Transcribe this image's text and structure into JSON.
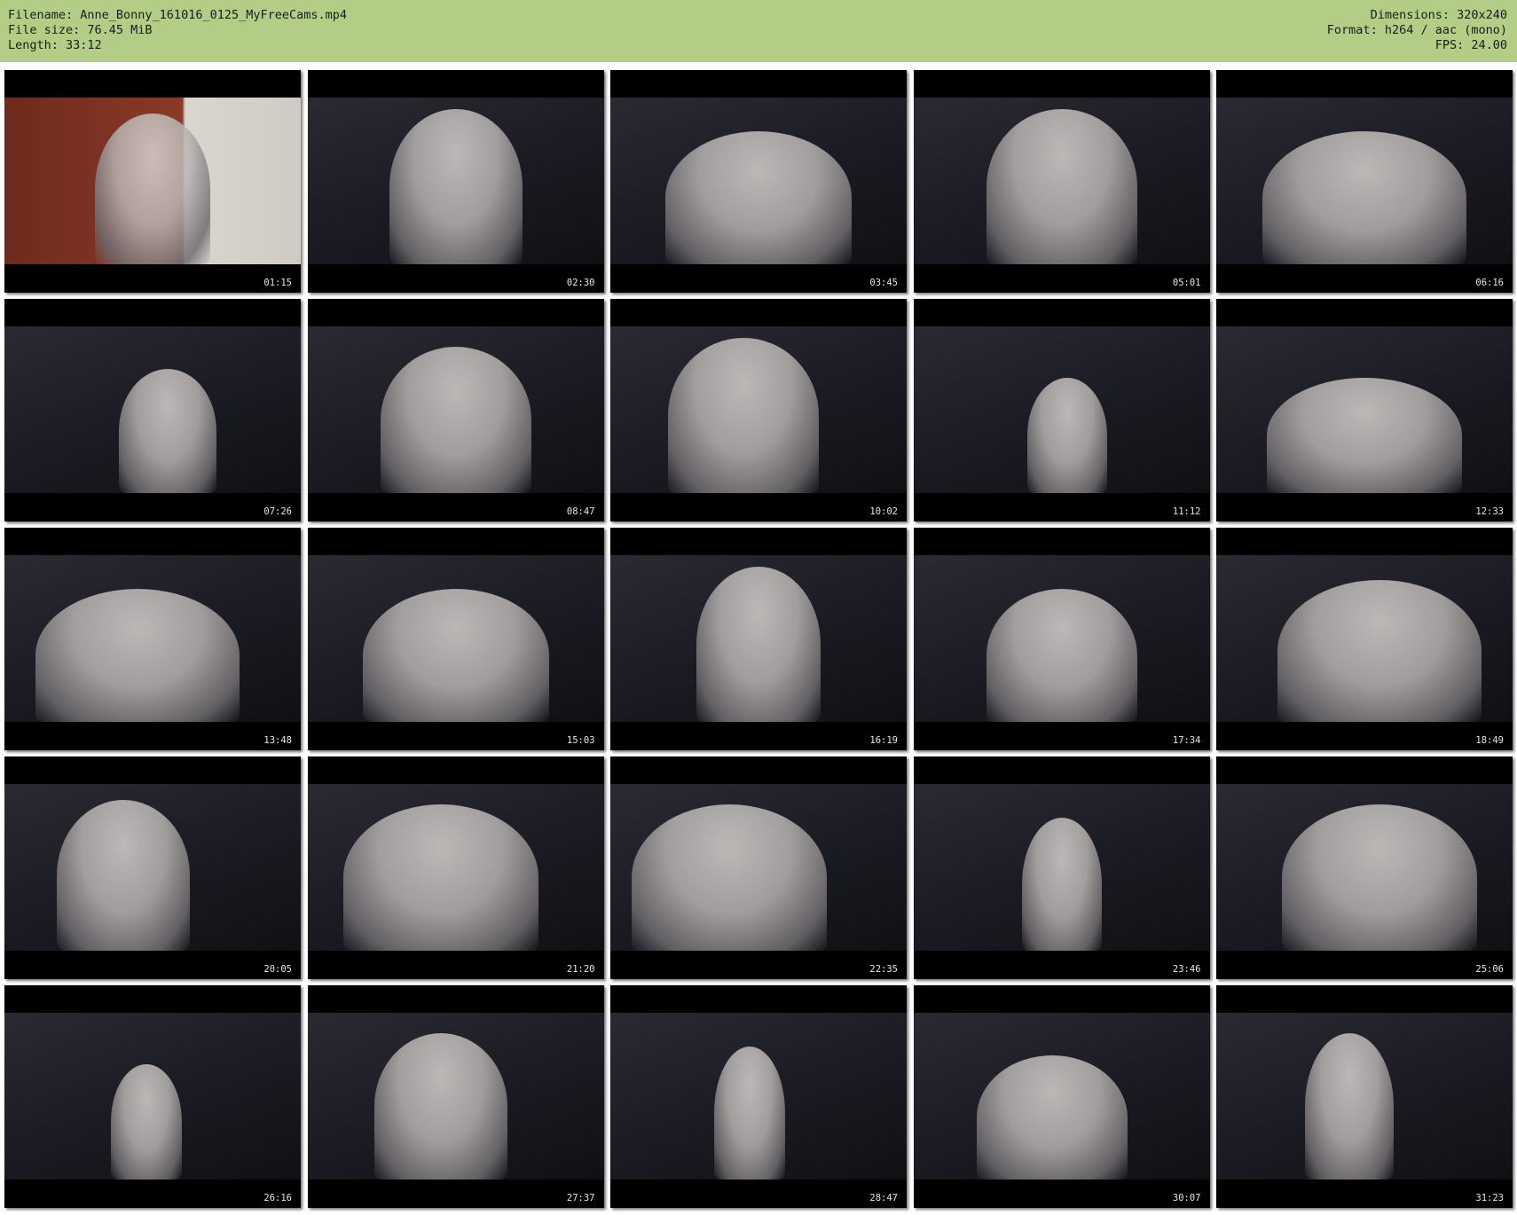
{
  "header": {
    "filename": "Filename: Anne_Bonny_161016_0125_MyFreeCams.mp4",
    "filesize": "File size: 76.45 MiB",
    "length": "Length: 33:12",
    "dimensions": "Dimensions: 320x240",
    "format": "Format: h264 / aac (mono)",
    "fps": "FPS: 24.00"
  },
  "thumbnails": [
    {
      "time": "01:15"
    },
    {
      "time": "02:30"
    },
    {
      "time": "03:45"
    },
    {
      "time": "05:01"
    },
    {
      "time": "06:16"
    },
    {
      "time": "07:26"
    },
    {
      "time": "08:47"
    },
    {
      "time": "10:02"
    },
    {
      "time": "11:12"
    },
    {
      "time": "12:33"
    },
    {
      "time": "13:48"
    },
    {
      "time": "15:03"
    },
    {
      "time": "16:19"
    },
    {
      "time": "17:34"
    },
    {
      "time": "18:49"
    },
    {
      "time": "20:05"
    },
    {
      "time": "21:20"
    },
    {
      "time": "22:35"
    },
    {
      "time": "23:46"
    },
    {
      "time": "25:06"
    },
    {
      "time": "26:16"
    },
    {
      "time": "27:37"
    },
    {
      "time": "28:47"
    },
    {
      "time": "30:07"
    },
    {
      "time": "31:23"
    }
  ]
}
